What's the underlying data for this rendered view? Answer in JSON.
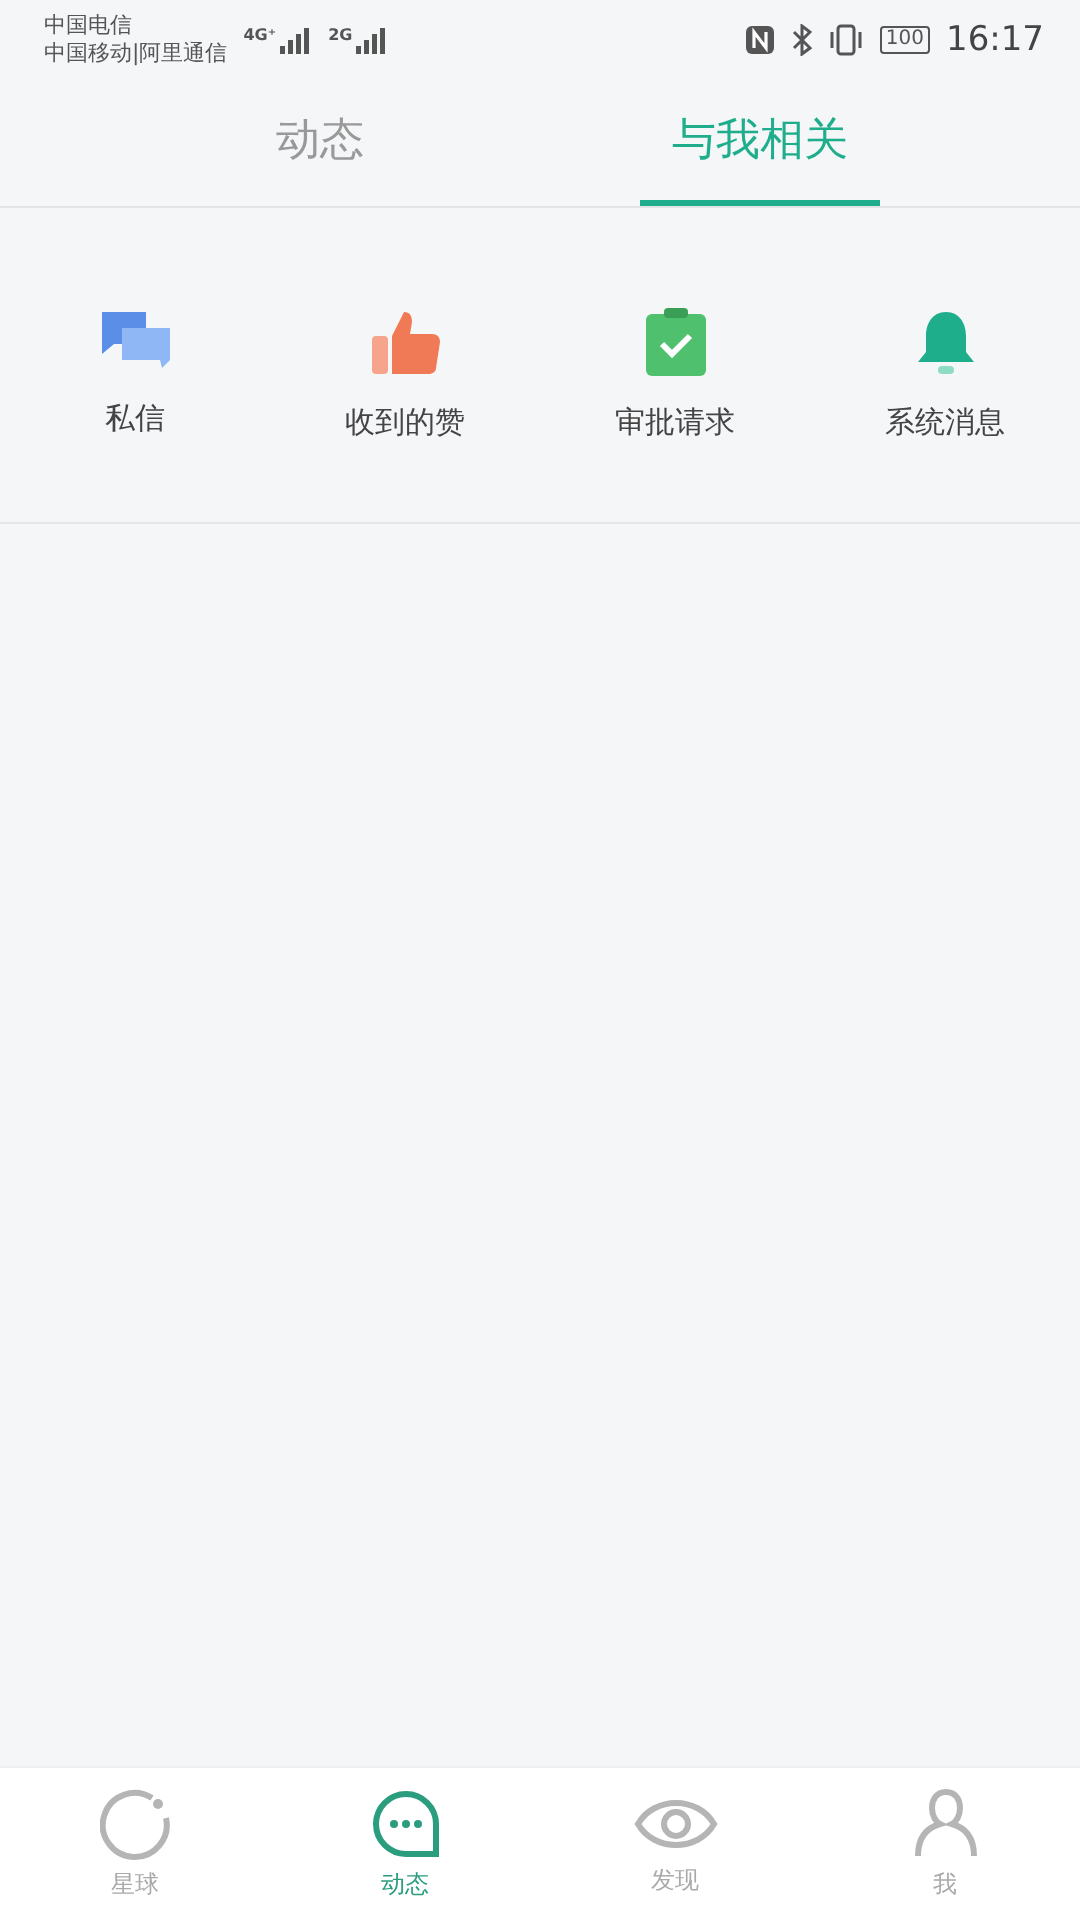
{
  "status_bar": {
    "carriers": [
      "中国电信",
      "中国移动|阿里通信"
    ],
    "networks": [
      "4G⁺",
      "2G"
    ],
    "battery": "100",
    "time": "16:17"
  },
  "tabs": [
    {
      "label": "动态",
      "selected": false
    },
    {
      "label": "与我相关",
      "selected": true
    }
  ],
  "shortcuts": [
    {
      "kind": "chat",
      "label": "私信"
    },
    {
      "kind": "thumb",
      "label": "收到的赞"
    },
    {
      "kind": "clipboard",
      "label": "审批请求"
    },
    {
      "kind": "bell",
      "label": "系统消息"
    }
  ],
  "bottom_nav": [
    {
      "kind": "planet",
      "label": "星球",
      "selected": false
    },
    {
      "kind": "chat",
      "label": "动态",
      "selected": true
    },
    {
      "kind": "eye",
      "label": "发现",
      "selected": false
    },
    {
      "kind": "person",
      "label": "我",
      "selected": false
    }
  ]
}
